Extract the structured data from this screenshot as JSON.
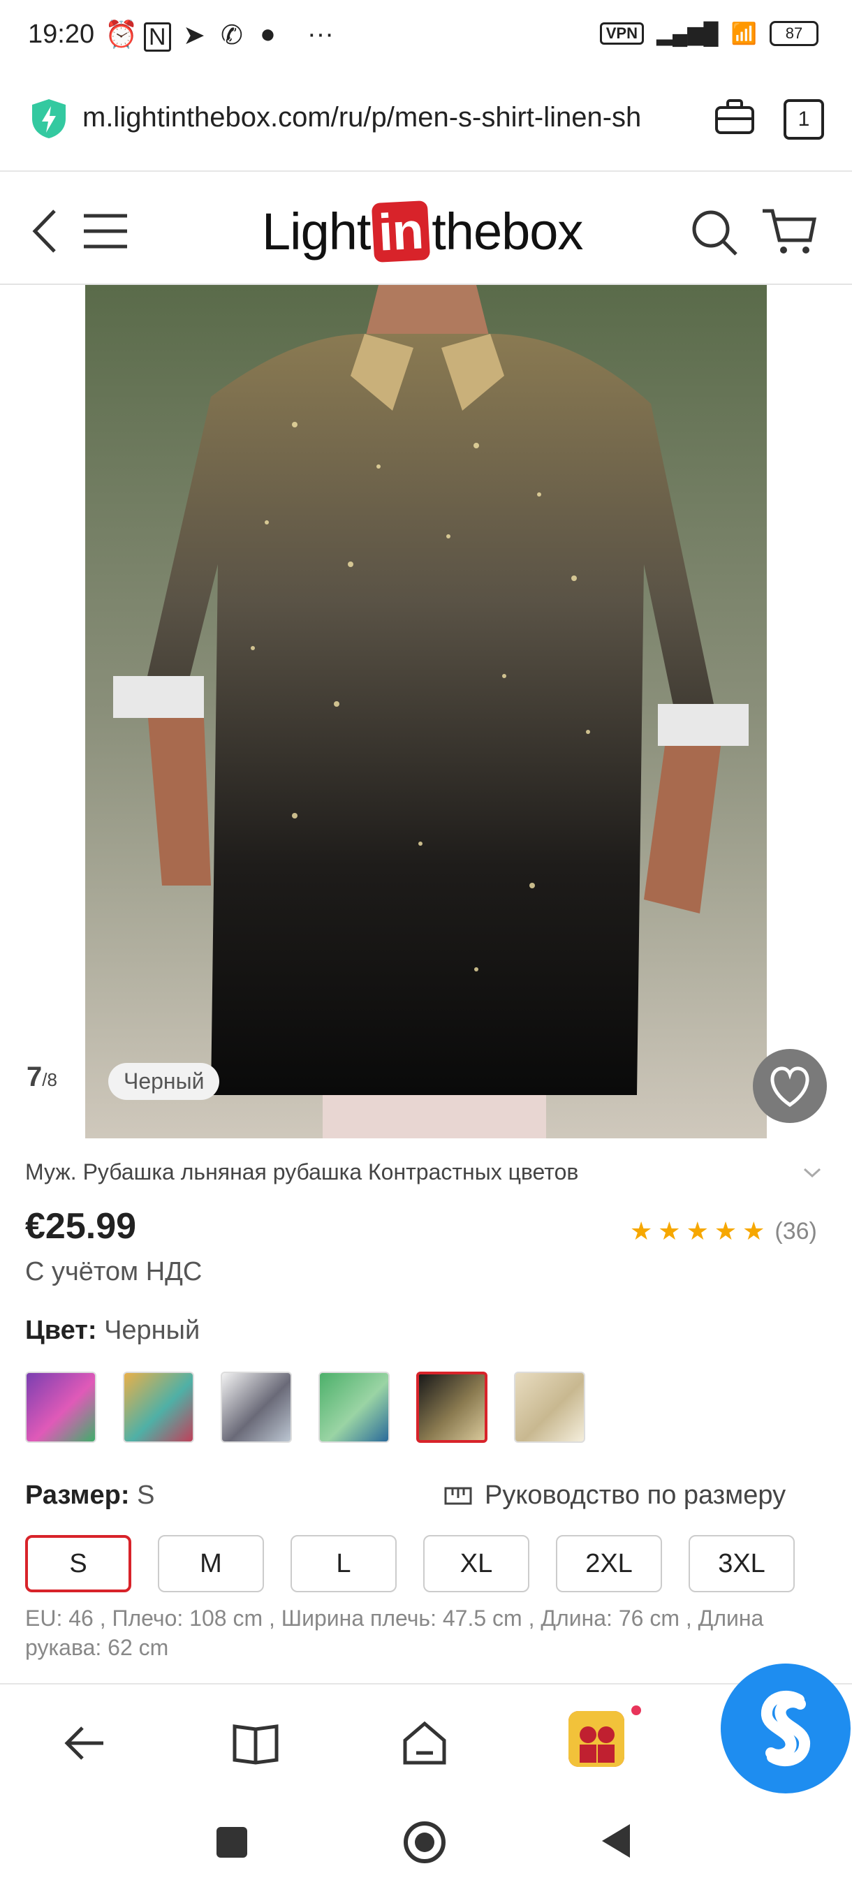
{
  "status_bar": {
    "time": "19:20",
    "vpn": "VPN",
    "battery": "87"
  },
  "browser": {
    "url": "m.lightinthebox.com/ru/p/men-s-shirt-linen-sh",
    "tab_count": "1"
  },
  "site": {
    "logo_pre": "Light",
    "logo_in": "in",
    "logo_post": "thebox"
  },
  "gallery": {
    "current": "7",
    "total": "/8",
    "color_tag": "Черный"
  },
  "product": {
    "title": "Муж. Рубашка льняная рубашка Контрастных цветов",
    "price": "€25.99",
    "vat_note": "С учётом НДС",
    "rating": 4.5,
    "reviews": "(36)"
  },
  "color": {
    "label": "Цвет:",
    "selected": "Черный",
    "swatches": [
      {
        "name": "multicolor-1",
        "colors": [
          "#7a3fb0",
          "#e05ab8",
          "#3fae6a"
        ]
      },
      {
        "name": "multicolor-2",
        "colors": [
          "#e8b04a",
          "#4fb0a6",
          "#c0405a"
        ]
      },
      {
        "name": "white-print",
        "colors": [
          "#f2f2f2",
          "#6a6a78",
          "#bcc6d2"
        ]
      },
      {
        "name": "green-gradient",
        "colors": [
          "#4cb06a",
          "#9ad4a4",
          "#2a6a9a"
        ]
      },
      {
        "name": "black-glitter",
        "colors": [
          "#1a1a1a",
          "#8a7a50",
          "#d8c89a"
        ],
        "selected": true
      },
      {
        "name": "beige-print",
        "colors": [
          "#e8dcc0",
          "#c8b890",
          "#f4eedc"
        ]
      }
    ]
  },
  "size": {
    "label": "Размер:",
    "selected": "S",
    "guide": "Руководство по размеру",
    "options": [
      "S",
      "M",
      "L",
      "XL",
      "2XL",
      "3XL"
    ],
    "measures": "EU: 46 , Плечо: 108 cm , Ширина плечь: 47.5 cm , Длина: 76 cm , Длина рукава: 62 cm"
  }
}
